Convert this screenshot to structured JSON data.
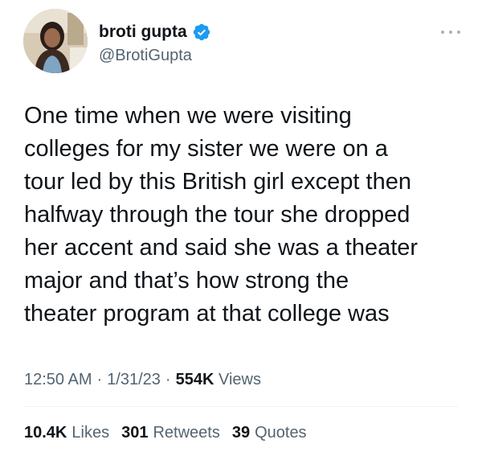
{
  "author": {
    "display_name": "broti gupta",
    "handle": "@BrotiGupta",
    "verified_icon": "verified-badge-icon",
    "avatar_icon": "avatar-photo"
  },
  "tweet": {
    "lines": [
      "One time when we were visiting",
      "colleges for my sister we were on a",
      "tour led by this British girl except then",
      "halfway through the tour she dropped",
      "her accent and said she was a theater",
      "major and that’s how strong the",
      "theater program at that college was"
    ]
  },
  "meta": {
    "time": "12:50 AM",
    "separator": "·",
    "date": "1/31/23",
    "views_count": "554K",
    "views_label": "Views"
  },
  "stats": {
    "likes_count": "10.4K",
    "likes_label": "Likes",
    "retweets_count": "301",
    "retweets_label": "Retweets",
    "quotes_count": "39",
    "quotes_label": "Quotes"
  },
  "colors": {
    "text": "#0f1419",
    "secondary": "#536471",
    "verified_blue": "#1d9bf0"
  }
}
